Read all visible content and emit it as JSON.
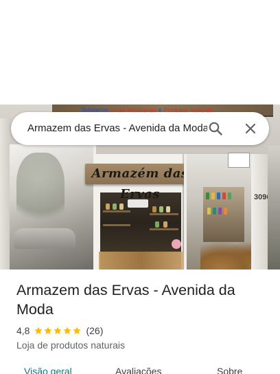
{
  "photo": {
    "top_sign_text_blue_1": "Temperos",
    "top_sign_text_red_1": "Ervas Medicinais",
    "top_sign_text_blue_2": "e",
    "top_sign_text_red_2": "Produtos Naturais",
    "shop_sign_text": "Armazém das Ervas",
    "house_number": "3096"
  },
  "search": {
    "query": "Armazem das Ervas - Avenida da Moda",
    "search_icon": "search-icon",
    "close_icon": "close-icon"
  },
  "place": {
    "title": "Armazem das Ervas - Avenida da Moda",
    "rating": "4,8",
    "stars": 5,
    "review_count": "(26)",
    "category": "Loja de produtos naturais"
  },
  "tabs": [
    {
      "label": "Visão geral",
      "active": true
    },
    {
      "label": "Avaliações",
      "active": false
    },
    {
      "label": "Sobre",
      "active": false
    }
  ],
  "colors": {
    "accent": "#0b7a8a",
    "star": "#fbbc04",
    "text_primary": "#202124",
    "text_secondary": "#5f6368"
  }
}
